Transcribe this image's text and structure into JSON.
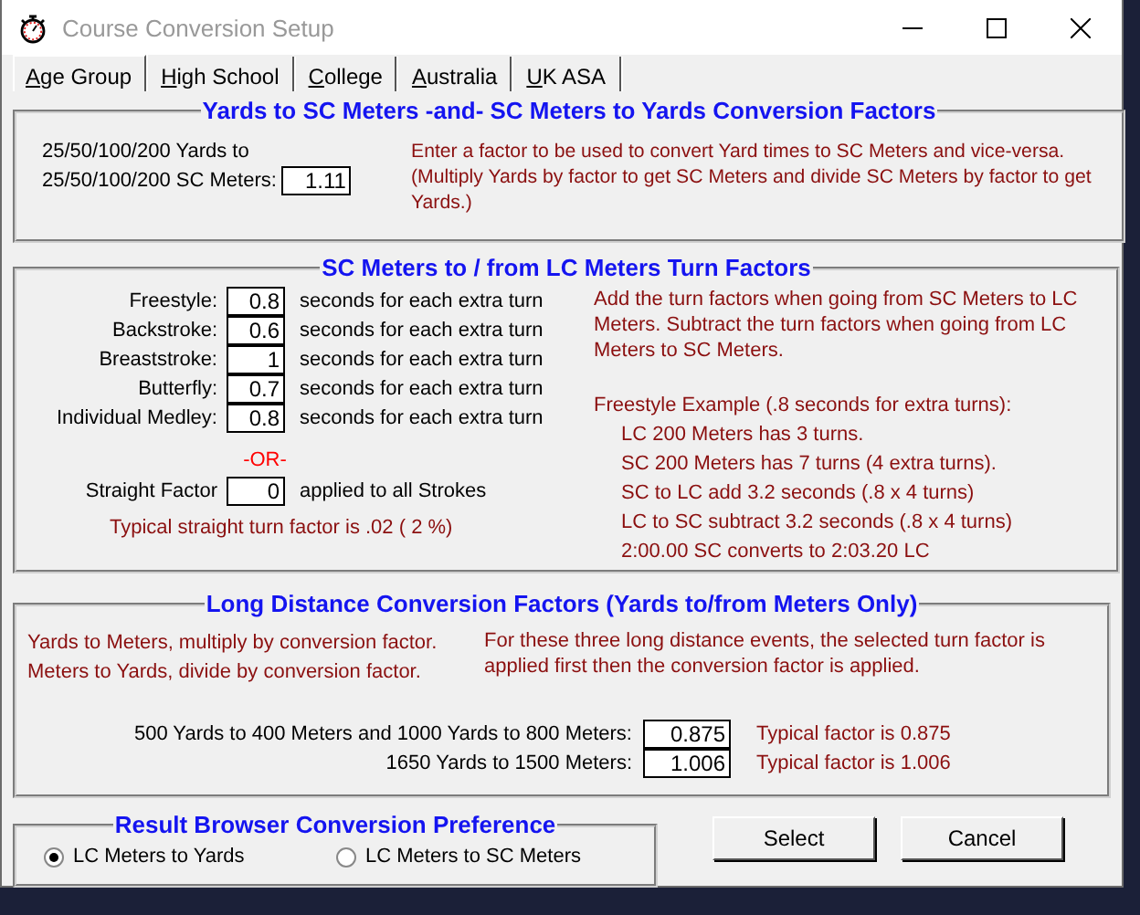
{
  "window": {
    "title": "Course Conversion Setup"
  },
  "tabs": [
    {
      "label": "Age Group",
      "selected": true
    },
    {
      "label": "High School",
      "selected": false
    },
    {
      "label": "College",
      "selected": false
    },
    {
      "label": "Australia",
      "selected": false
    },
    {
      "label": "UK ASA",
      "selected": false
    }
  ],
  "yards_sc_section": {
    "title": "Yards to SC Meters -and- SC Meters to Yards Conversion Factors",
    "label_lines": [
      "25/50/100/200 Yards to",
      "25/50/100/200 SC Meters:"
    ],
    "factor": "1.11",
    "description": "Enter a factor to be used to convert Yard times to SC Meters and vice-versa. (Multiply Yards by factor to get SC Meters and divide SC Meters by factor to get Yards.)"
  },
  "turn_section": {
    "title": "SC Meters to / from LC Meters Turn Factors",
    "strokes": [
      {
        "label": "Freestyle:",
        "value": "0.8",
        "unit": "seconds for each extra turn"
      },
      {
        "label": "Backstroke:",
        "value": "0.6",
        "unit": "seconds for each extra turn"
      },
      {
        "label": "Breaststroke:",
        "value": "1",
        "unit": "seconds for each extra turn"
      },
      {
        "label": "Butterfly:",
        "value": "0.7",
        "unit": "seconds for each extra turn"
      },
      {
        "label": "Individual Medley:",
        "value": "0.8",
        "unit": "seconds for each extra turn"
      }
    ],
    "or_label": "-OR-",
    "straight": {
      "label": "Straight Factor",
      "value": "0",
      "unit": "applied to all Strokes"
    },
    "typical_note": "Typical straight turn factor is  .02  ( 2 %)",
    "description": "Add the turn factors when going from SC Meters to LC Meters. Subtract the turn factors when going from LC Meters to SC Meters.",
    "example_title": "Freestyle Example (.8 seconds for extra turns):",
    "example_lines": [
      "LC 200 Meters has 3 turns.",
      "SC 200 Meters has 7 turns (4 extra turns).",
      "SC to LC add 3.2 seconds (.8 x 4 turns)",
      "LC to SC subtract 3.2 seconds (.8 x 4 turns)",
      "2:00.00 SC converts to 2:03.20 LC"
    ]
  },
  "long_distance_section": {
    "title": "Long Distance Conversion Factors (Yards to/from Meters Only)",
    "left_notes": [
      "Yards to Meters, multiply by conversion factor.",
      "Meters to Yards, divide by conversion factor."
    ],
    "right_note": "For these three long distance events, the selected turn factor is applied first then the conversion factor is applied.",
    "rows": [
      {
        "label": "500 Yards to 400 Meters and 1000 Yards  to 800 Meters:",
        "value": "0.875",
        "typical": "Typical factor is 0.875"
      },
      {
        "label": "1650 Yards to 1500 Meters:",
        "value": "1.006",
        "typical": "Typical factor is 1.006"
      }
    ]
  },
  "preference": {
    "title": "Result Browser Conversion  Preference",
    "options": [
      {
        "label": "LC Meters to Yards",
        "selected": true
      },
      {
        "label": "LC Meters to SC Meters",
        "selected": false
      }
    ]
  },
  "buttons": [
    "Select",
    "Cancel"
  ]
}
